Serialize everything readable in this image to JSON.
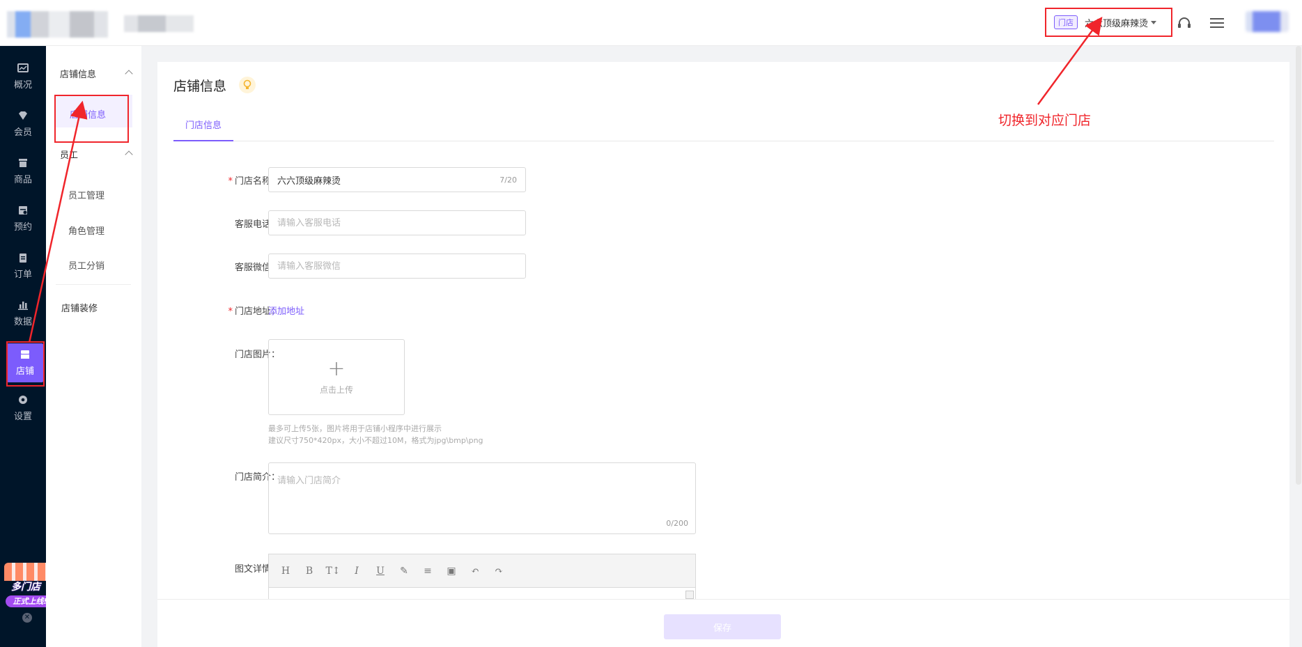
{
  "header": {
    "store_tag": "门店",
    "store_name": "六六顶级麻辣烫"
  },
  "rail": {
    "items": [
      {
        "label": "概况",
        "icon": "overview-icon"
      },
      {
        "label": "会员",
        "icon": "diamond-icon"
      },
      {
        "label": "商品",
        "icon": "box-icon"
      },
      {
        "label": "预约",
        "icon": "calendar-icon"
      },
      {
        "label": "订单",
        "icon": "clipboard-icon"
      },
      {
        "label": "数据",
        "icon": "bar-chart-icon"
      },
      {
        "label": "店铺",
        "icon": "store-icon"
      },
      {
        "label": "设置",
        "icon": "gear-icon"
      }
    ],
    "promo_title": "多门店",
    "promo_sub": "正式上线!"
  },
  "subnav": {
    "group1": "店铺信息",
    "group1_item": "店铺信息",
    "group2": "员工",
    "items": [
      "员工管理",
      "角色管理",
      "员工分销"
    ],
    "bottom": "店铺装修"
  },
  "main": {
    "title": "店铺信息",
    "tab": "门店信息",
    "fields": {
      "name_label": "门店名称",
      "name_value": "六六顶级麻辣烫",
      "name_count": "7/20",
      "phone_label": "客服电话",
      "phone_placeholder": "请输入客服电话",
      "wechat_label": "客服微信",
      "wechat_placeholder": "请输入客服微信",
      "address_label": "门店地址",
      "address_link": "添加地址",
      "image_label": "门店图片",
      "upload_text": "点击上传",
      "hint1": "最多可上传5张，图片将用于店铺小程序中进行展示",
      "hint2": "建议尺寸750*420px，大小不超过10M，格式为jpg\\bmp\\png",
      "intro_label": "门店简介",
      "intro_placeholder": "请输入门店简介",
      "intro_count": "0/200",
      "detail_label": "图文详情"
    },
    "toolbar": [
      "H",
      "B",
      "T↕",
      "I",
      "U",
      "✎",
      "≡",
      "▣",
      "↶",
      "↷"
    ],
    "save": "保存"
  },
  "annotation": {
    "text": "切换到对应门店",
    "color": "#f0252b"
  },
  "colors": {
    "accent": "#7c5cfc",
    "rail_bg": "#001529",
    "annotation": "#f0252b"
  }
}
